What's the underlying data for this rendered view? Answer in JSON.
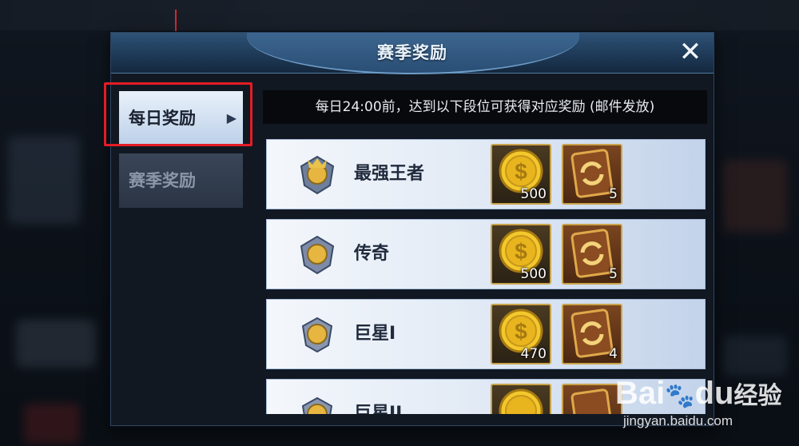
{
  "dialog": {
    "title": "赛季奖励",
    "close_icon": "close-icon"
  },
  "tabs": [
    {
      "label": "每日奖励",
      "selected": true
    },
    {
      "label": "赛季奖励",
      "selected": false
    }
  ],
  "notice": "每日24:00前，达到以下段位可获得对应奖励 (邮件发放)",
  "rewards": [
    {
      "rank": "最强王者",
      "coin_qty": "500",
      "card_qty": "5"
    },
    {
      "rank": "传奇",
      "coin_qty": "500",
      "card_qty": "5"
    },
    {
      "rank": "巨星I",
      "coin_qty": "470",
      "card_qty": "4"
    },
    {
      "rank": "巨星II",
      "coin_qty": "",
      "card_qty": ""
    }
  ],
  "watermark": {
    "brand": "Bai",
    "brand2": "du",
    "cn": "经验",
    "url": "jingyan.baidu.com"
  },
  "colors": {
    "highlight": "#e41c24",
    "accent_gold": "#c9a24a",
    "header_blue": "#2f5276"
  }
}
